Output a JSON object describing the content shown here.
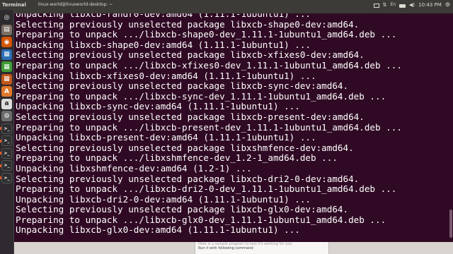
{
  "top_panel": {
    "app_title": "Terminal",
    "time": "10:43 PM"
  },
  "window": {
    "title": "linux-world@linuxworld-desktop: ~"
  },
  "terminal": {
    "lines": [
      "Unpacking libxcb-randr0-dev:amd64 (1.11.1-1ubuntu1) ...",
      "Selecting previously unselected package libxcb-shape0-dev:amd64.",
      "Preparing to unpack .../libxcb-shape0-dev_1.11.1-1ubuntu1_amd64.deb ...",
      "Unpacking libxcb-shape0-dev:amd64 (1.11.1-1ubuntu1) ...",
      "Selecting previously unselected package libxcb-xfixes0-dev:amd64.",
      "Preparing to unpack .../libxcb-xfixes0-dev_1.11.1-1ubuntu1_amd64.deb ...",
      "Unpacking libxcb-xfixes0-dev:amd64 (1.11.1-1ubuntu1) ...",
      "Selecting previously unselected package libxcb-sync-dev:amd64.",
      "Preparing to unpack .../libxcb-sync-dev_1.11.1-1ubuntu1_amd64.deb ...",
      "Unpacking libxcb-sync-dev:amd64 (1.11.1-1ubuntu1) ...",
      "Selecting previously unselected package libxcb-present-dev:amd64.",
      "Preparing to unpack .../libxcb-present-dev_1.11.1-1ubuntu1_amd64.deb ...",
      "Unpacking libxcb-present-dev:amd64 (1.11.1-1ubuntu1) ...",
      "Selecting previously unselected package libxshmfence-dev:amd64.",
      "Preparing to unpack .../libxshmfence-dev_1.2-1_amd64.deb ...",
      "Unpacking libxshmfence-dev:amd64 (1.2-1) ...",
      "Selecting previously unselected package libxcb-dri2-0-dev:amd64.",
      "Preparing to unpack .../libxcb-dri2-0-dev_1.11.1-1ubuntu1_amd64.deb ...",
      "Unpacking libxcb-dri2-0-dev:amd64 (1.11.1-1ubuntu1) ...",
      "Selecting previously unselected package libxcb-glx0-dev:amd64.",
      "Preparing to unpack .../libxcb-glx0-dev_1.11.1-1ubuntu1_amd64.deb ...",
      "Unpacking libxcb-glx0-dev:amd64 (1.11.1-1ubuntu1) ..."
    ]
  },
  "launcher": {
    "items": [
      {
        "icon": "ubuntu-dash-icon",
        "color": "#2c2c2c"
      },
      {
        "icon": "files-icon",
        "color": "#7c6f64"
      },
      {
        "icon": "firefox-icon",
        "color": "#d35400"
      },
      {
        "icon": "libreoffice-writer-icon",
        "color": "#2a6fb5"
      },
      {
        "icon": "libreoffice-calc-icon",
        "color": "#3e9c35"
      },
      {
        "icon": "libreoffice-impress-icon",
        "color": "#c2571c"
      },
      {
        "icon": "software-center-icon",
        "color": "#e0772a"
      },
      {
        "icon": "amazon-icon",
        "color": "#dddddd"
      },
      {
        "icon": "system-settings-icon",
        "color": "#6d6d6d"
      },
      {
        "icon": "terminal-icon",
        "color": "#2f2f2f"
      },
      {
        "icon": "terminal-icon",
        "color": "#2f2f2f"
      },
      {
        "icon": "terminal-icon",
        "color": "#2f2f2f"
      },
      {
        "icon": "terminal-icon",
        "color": "#2f2f2f"
      },
      {
        "icon": "terminal-icon",
        "color": "#2f2f2f"
      }
    ]
  },
  "bottom_doc": {
    "line1": "Here is a sample program to test it's working for you:",
    "line2": "Run it with following command:"
  },
  "colors": {
    "terminal_bg": "#300a24",
    "terminal_fg": "#ffffff",
    "panel_bg": "#3c3b37",
    "accent": "#e95420"
  }
}
